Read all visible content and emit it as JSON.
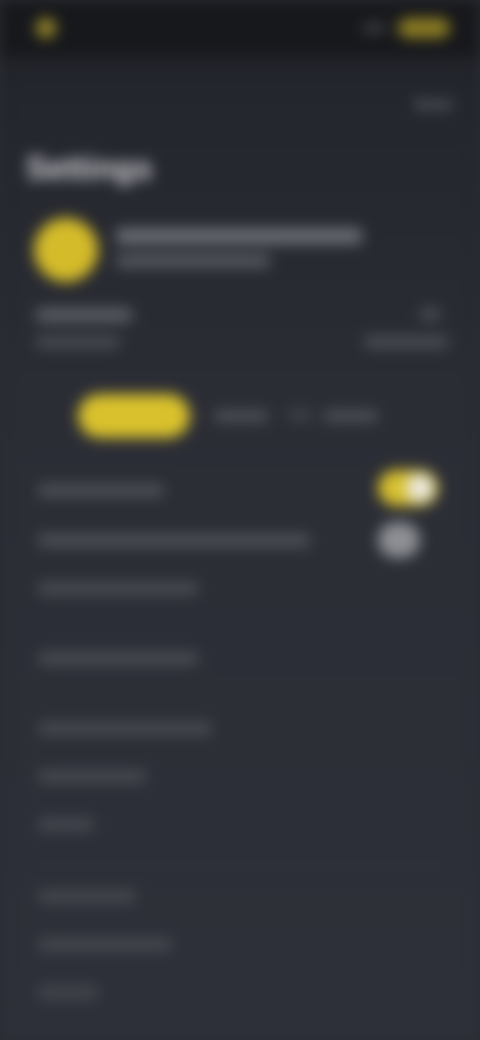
{
  "header": {
    "title": "Settings",
    "done_label": "Done"
  },
  "colors": {
    "accent": "#d9c12d",
    "background": "#2b2d35",
    "text_primary": "#d8d9de",
    "text_secondary": "#a6a8b0"
  },
  "icons": {
    "avatar": "user-avatar",
    "status_logo": "app-logo-icon"
  },
  "toggles": {
    "first_on": true,
    "second_on": false
  }
}
